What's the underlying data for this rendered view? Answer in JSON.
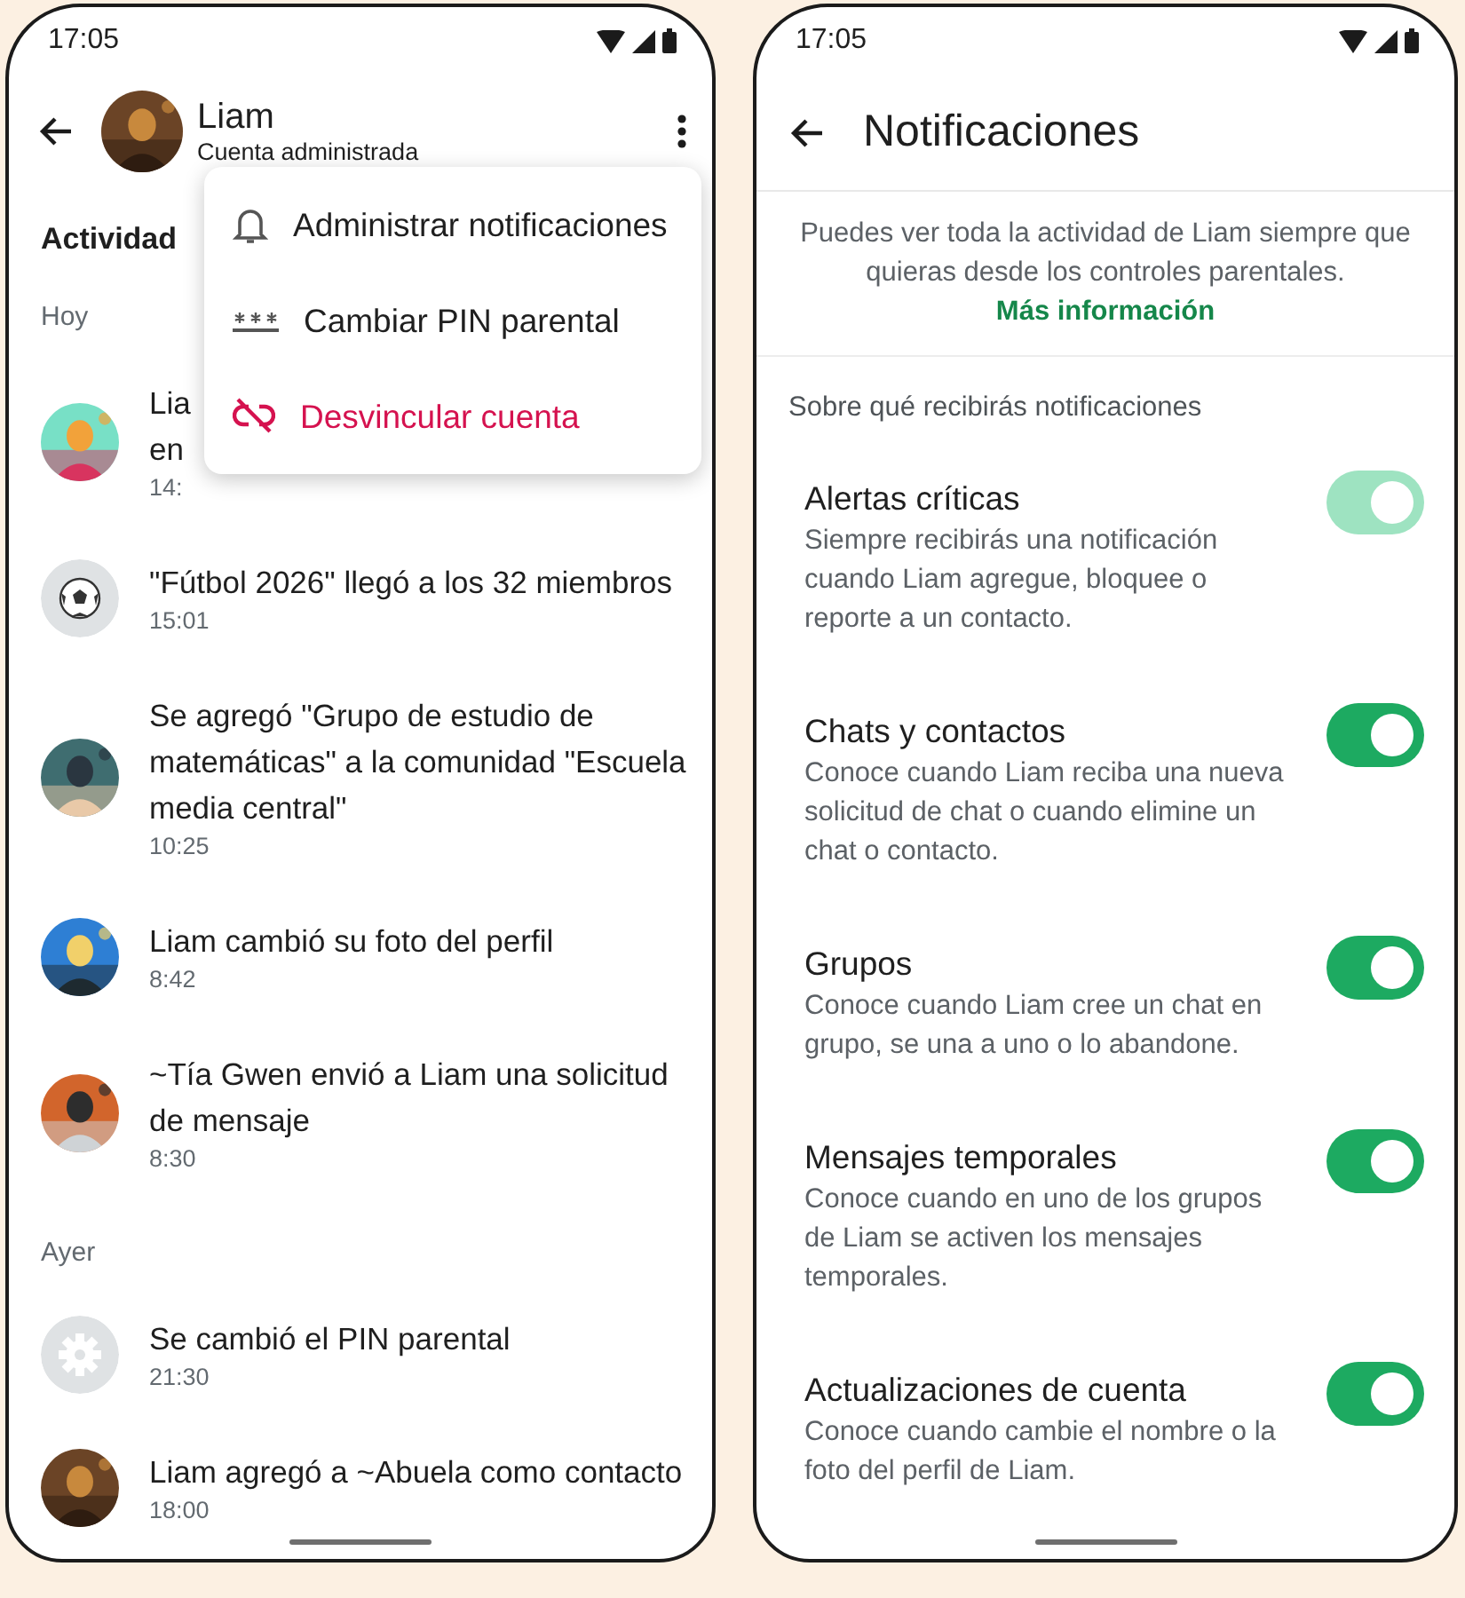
{
  "left_screen": {
    "status_bar": {
      "time": "17:05"
    },
    "header": {
      "name": "Liam",
      "subtitle": "Cuenta administrada"
    },
    "section_title": "Actividad",
    "groups": [
      {
        "label": "Hoy",
        "items": [
          {
            "avatar": {
              "kind": "picture"
            },
            "lines": [
              "Lia",
              "en"
            ],
            "time": "14:"
          },
          {
            "avatar": {
              "kind": "soccer"
            },
            "lines": [
              "\"Fútbol 2026\" llegó a los 32 miembros"
            ],
            "time": "15:01"
          },
          {
            "avatar": {
              "kind": "picture"
            },
            "lines": [
              "Se agregó \"Grupo de estudio de matemáticas\" a la comunidad \"Escuela media central\""
            ],
            "time": "10:25"
          },
          {
            "avatar": {
              "kind": "picture"
            },
            "lines": [
              "Liam cambió su foto del perfil"
            ],
            "time": "8:42"
          },
          {
            "avatar": {
              "kind": "picture"
            },
            "lines": [
              "~Tía Gwen envió a Liam una solicitud de mensaje"
            ],
            "time": "8:30"
          }
        ]
      },
      {
        "label": "Ayer",
        "items": [
          {
            "avatar": {
              "kind": "gear"
            },
            "lines": [
              "Se cambió el PIN parental"
            ],
            "time": "21:30"
          },
          {
            "avatar": {
              "kind": "picture"
            },
            "lines": [
              "Liam agregó a ~Abuela como contacto"
            ],
            "time": "18:00"
          }
        ]
      }
    ],
    "menu": {
      "items": [
        {
          "kind": "bell",
          "label": "Administrar notificaciones",
          "destructive": false
        },
        {
          "kind": "pin",
          "label": "Cambiar PIN parental",
          "destructive": false
        },
        {
          "kind": "unlink",
          "label": "Desvincular cuenta",
          "destructive": true
        }
      ]
    }
  },
  "right_screen": {
    "status_bar": {
      "time": "17:05"
    },
    "title": "Notificaciones",
    "info": "Puedes ver toda la actividad de Liam siempre que quieras desde los controles parentales.",
    "link": "Más información",
    "section_label": "Sobre qué recibirás notificaciones",
    "settings": [
      {
        "title": "Alertas críticas",
        "description": "Siempre recibirás una notificación cuando Liam agregue, bloquee o reporte a un contacto.",
        "on": true,
        "disabled": true
      },
      {
        "title": "Chats y contactos",
        "description": "Conoce cuando Liam reciba una nueva solicitud de chat o cuando elimine un chat o contacto.",
        "on": true,
        "disabled": false
      },
      {
        "title": "Grupos",
        "description": "Conoce cuando Liam cree un chat en grupo, se una a uno o lo abandone.",
        "on": true,
        "disabled": false
      },
      {
        "title": "Mensajes temporales",
        "description": "Conoce cuando en uno de los grupos de Liam se activen los mensajes temporales.",
        "on": true,
        "disabled": false
      },
      {
        "title": "Actualizaciones de cuenta",
        "description": "Conoce cuando cambie el nombre o la foto del perfil de Liam.",
        "on": true,
        "disabled": false
      }
    ]
  }
}
